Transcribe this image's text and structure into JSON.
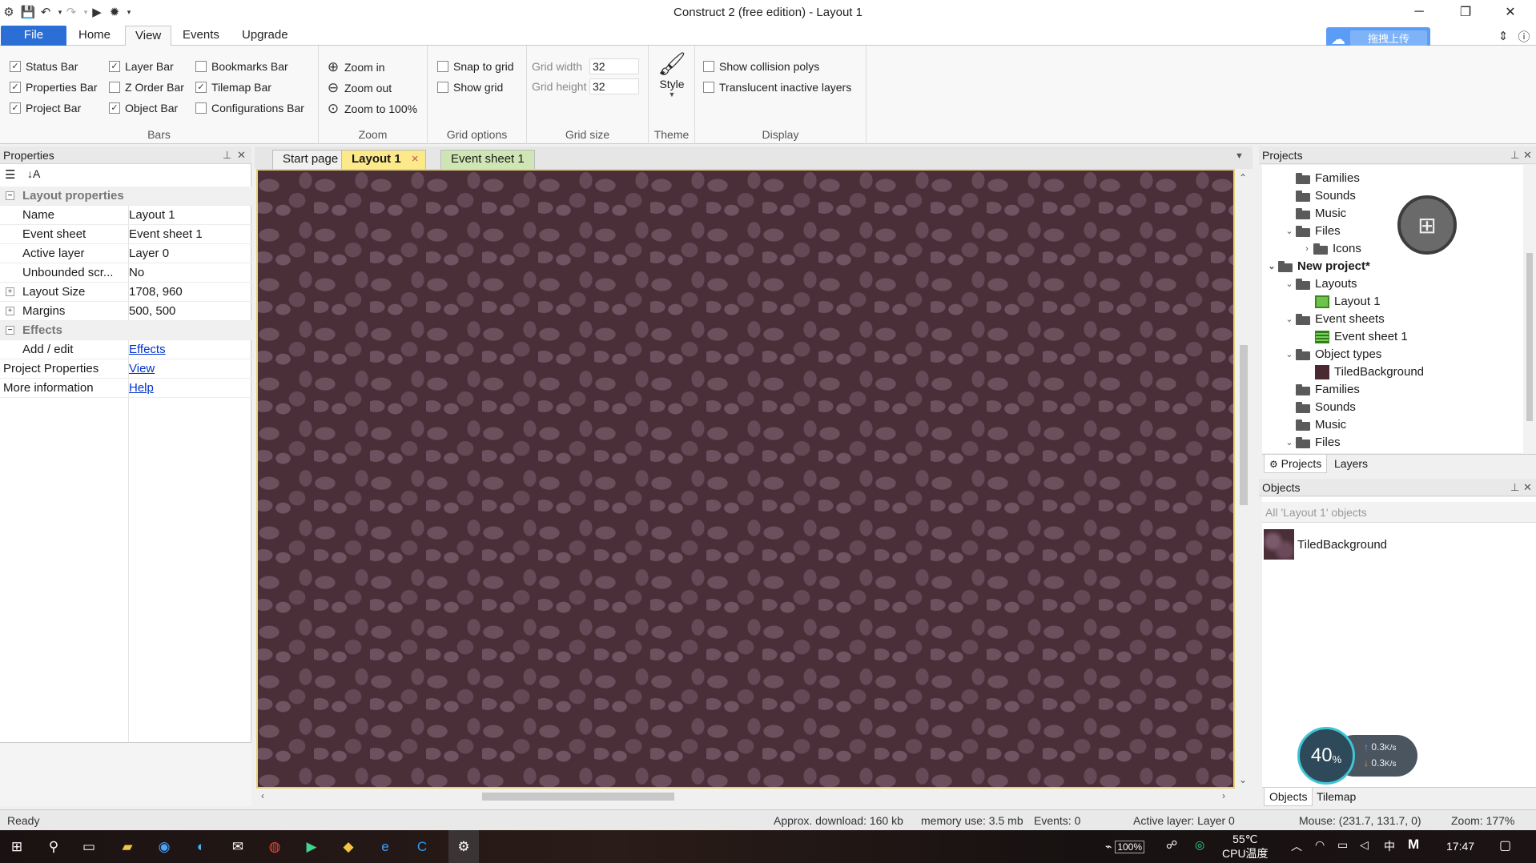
{
  "window": {
    "title": "Construct 2  (free edition) - Layout 1"
  },
  "ribbon_tabs": [
    "File",
    "Home",
    "View",
    "Events",
    "Upgrade"
  ],
  "upload_button": "拖拽上传",
  "bars": {
    "label": "Bars",
    "items": [
      {
        "label": "Status Bar",
        "checked": true
      },
      {
        "label": "Properties Bar",
        "checked": true
      },
      {
        "label": "Project Bar",
        "checked": true
      },
      {
        "label": "Layer Bar",
        "checked": true
      },
      {
        "label": "Z Order Bar",
        "checked": false
      },
      {
        "label": "Object Bar",
        "checked": true
      },
      {
        "label": "Bookmarks Bar",
        "checked": false
      },
      {
        "label": "Tilemap Bar",
        "checked": true
      },
      {
        "label": "Configurations Bar",
        "checked": false
      }
    ]
  },
  "zoom": {
    "label": "Zoom",
    "zoom_in": "Zoom in",
    "zoom_out": "Zoom out",
    "zoom_100": "Zoom to 100%"
  },
  "grid_options": {
    "label": "Grid options",
    "snap": "Snap to grid",
    "show": "Show grid"
  },
  "grid_size": {
    "label": "Grid size",
    "width_label": "Grid width",
    "width_value": "32",
    "height_label": "Grid height",
    "height_value": "32"
  },
  "theme": {
    "label": "Theme",
    "style": "Style"
  },
  "display": {
    "label": "Display",
    "collision": "Show collision polys",
    "translucent": "Translucent inactive layers"
  },
  "properties": {
    "title": "Properties",
    "category_layout": "Layout properties",
    "rows": [
      {
        "key": "Name",
        "value": "Layout 1"
      },
      {
        "key": "Event sheet",
        "value": "Event sheet 1"
      },
      {
        "key": "Active layer",
        "value": "Layer 0"
      },
      {
        "key": "Unbounded scr...",
        "value": "No"
      },
      {
        "key": "Layout Size",
        "value": "1708, 960"
      },
      {
        "key": "Margins",
        "value": "500, 500"
      }
    ],
    "category_effects": "Effects",
    "effects_key": "Add / edit",
    "effects_link": "Effects",
    "project_key": "Project Properties",
    "project_link": "View",
    "info_key": "More information",
    "info_link": "Help"
  },
  "doc_tabs": [
    "Start page",
    "Layout 1",
    "Event sheet 1"
  ],
  "projects": {
    "title": "Projects",
    "tree": [
      {
        "label": "Families"
      },
      {
        "label": "Sounds"
      },
      {
        "label": "Music"
      },
      {
        "label": "Files"
      },
      {
        "label": "Icons"
      },
      {
        "label": "New project*"
      },
      {
        "label": "Layouts"
      },
      {
        "label": "Layout 1"
      },
      {
        "label": "Event sheets"
      },
      {
        "label": "Event sheet 1"
      },
      {
        "label": "Object types"
      },
      {
        "label": "TiledBackground"
      },
      {
        "label": "Families"
      },
      {
        "label": "Sounds"
      },
      {
        "label": "Music"
      },
      {
        "label": "Files"
      }
    ],
    "tabs": [
      "Projects",
      "Layers"
    ]
  },
  "objects": {
    "title": "Objects",
    "filter": "All 'Layout 1' objects",
    "item": "TiledBackground",
    "tabs": [
      "Objects",
      "Tilemap"
    ]
  },
  "speed_widget": {
    "percent": "40",
    "percent_sign": "%",
    "up": "0.3",
    "down": "0.3",
    "unit": "K/s"
  },
  "status": {
    "ready": "Ready",
    "download": "Approx. download: 160 kb",
    "memory": "memory use: 3.5 mb",
    "events": "Events: 0",
    "layer": "Active layer: Layer 0",
    "mouse": "Mouse: (231.7, 131.7, 0)",
    "zoom": "Zoom: 177%"
  },
  "taskbar": {
    "battery": "100%",
    "temp": "55℃",
    "temp_label": "CPU温度",
    "ime": "中",
    "time": "17:47"
  }
}
